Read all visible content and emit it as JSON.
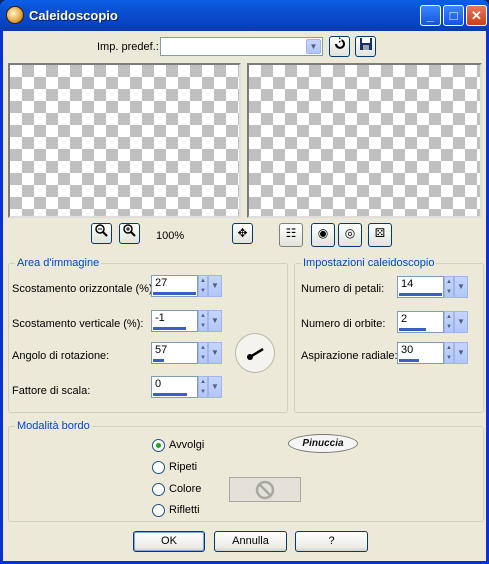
{
  "window": {
    "title": "Caleidoscopio",
    "minimize": "_",
    "maximize": "□",
    "close": "✕"
  },
  "preset": {
    "label": "Imp. predef.:",
    "value": ""
  },
  "zoom": {
    "level": "100%"
  },
  "area": {
    "title": "Area d'immagine",
    "fields": [
      {
        "label": "Scostamento orizzontale (%):",
        "value": "27",
        "fill": 0.27
      },
      {
        "label": "Scostamento verticale (%):",
        "value": "-1",
        "fill": 0.49
      },
      {
        "label": "Angolo di rotazione:",
        "value": "57",
        "fill": 0.16
      },
      {
        "label": "Fattore di scala:",
        "value": "0",
        "fill": 0.5
      }
    ]
  },
  "settings": {
    "title": "Impostazioni caleidoscopio",
    "fields": [
      {
        "label": "Numero di petali:",
        "value": "14",
        "fill": 0.6
      },
      {
        "label": "Numero di orbite:",
        "value": "2",
        "fill": 0.4
      },
      {
        "label": "Aspirazione radiale:",
        "value": "30",
        "fill": 0.3
      }
    ]
  },
  "mode": {
    "title": "Modalità bordo",
    "options": [
      "Avvolgi",
      "Ripeti",
      "Colore",
      "Rifletti"
    ],
    "selected": "Avvolgi",
    "watermark": "Pinuccia"
  },
  "buttons": {
    "ok": "OK",
    "cancel": "Annulla",
    "help": "?"
  }
}
